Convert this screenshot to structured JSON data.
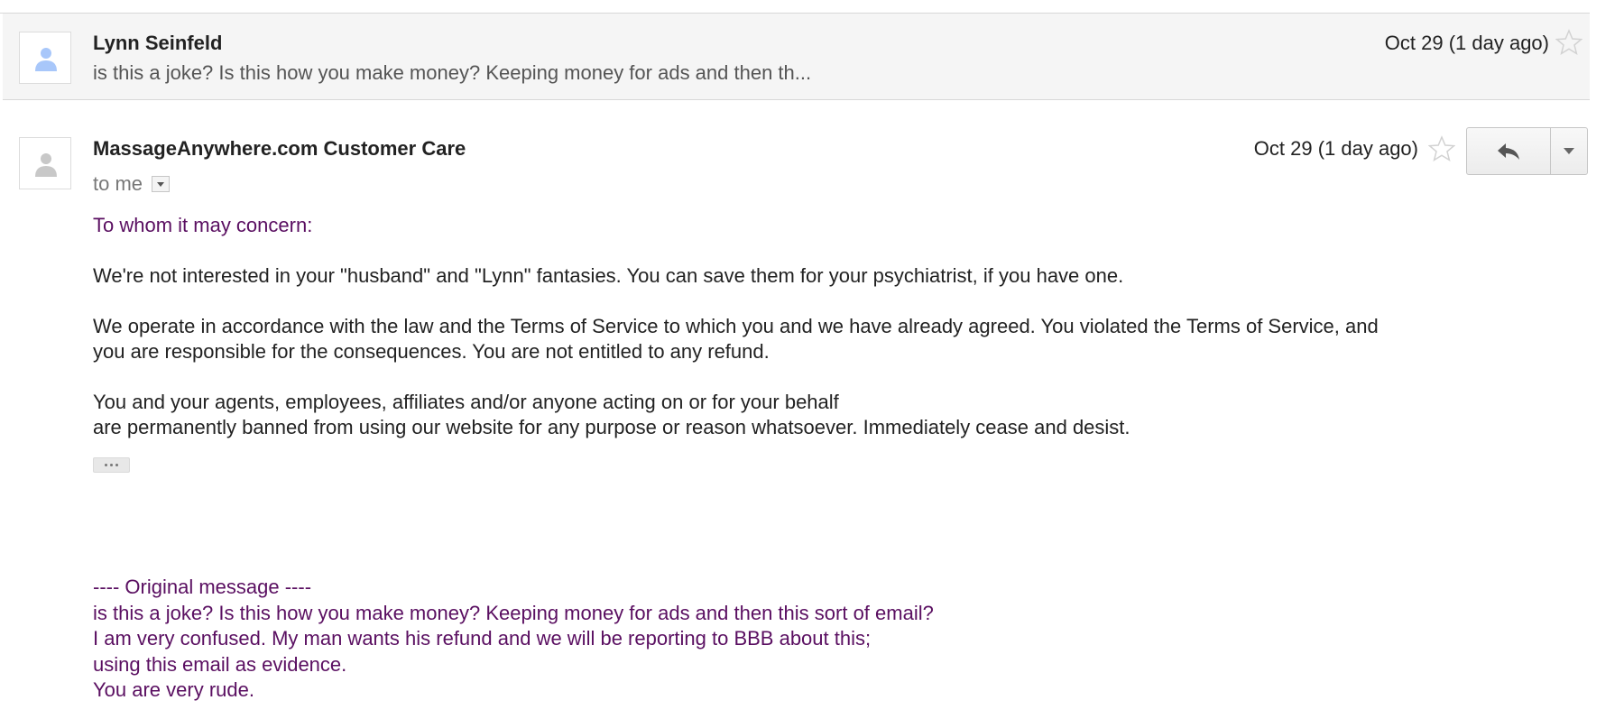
{
  "collapsed_message": {
    "sender": "Lynn Seinfeld",
    "date": "Oct 29 (1 day ago)",
    "snippet": "is this a joke? Is this how you make money? Keeping money for ads and then th..."
  },
  "open_message": {
    "sender": "MassageAnywhere.com Customer Care",
    "date": "Oct 29 (1 day ago)",
    "to_line": "to me",
    "greeting": "To whom it may concern:",
    "paragraph1": "We're not interested in your \"husband\" and \"Lynn\" fantasies.  You can save them for your psychiatrist, if you have one.",
    "paragraph2_line1": "We operate in accordance with the law and the Terms of Service to which you and we have already agreed.  You violated the Terms of Service, and",
    "paragraph2_line2": "you are responsible for the consequences.  You are not entitled to any refund.",
    "paragraph3_line1": "You and your agents, employees, affiliates and/or anyone acting on or for your behalf",
    "paragraph3_line2": "are permanently banned from using our website for any purpose or reason whatsoever.  Immediately cease and desist.",
    "quoted_lines": [
      "---- Original message ----",
      "is this a joke? Is this how you make money? Keeping money for ads and then this sort of email?",
      "I am very confused. My man wants his refund and we will be reporting to BBB about this;",
      "using this email as evidence.",
      "You are very rude."
    ]
  },
  "colors": {
    "quoted_text": "#5a0f61",
    "avatar_blue": "#a8c7fa",
    "avatar_grey": "#c8c8c8",
    "collapsed_bg": "#f5f5f5"
  },
  "icons": {
    "avatar_1": "person-icon",
    "avatar_2": "person-icon",
    "star": "star-outline-icon",
    "reply": "reply-arrow-icon",
    "more": "caret-down-icon"
  }
}
